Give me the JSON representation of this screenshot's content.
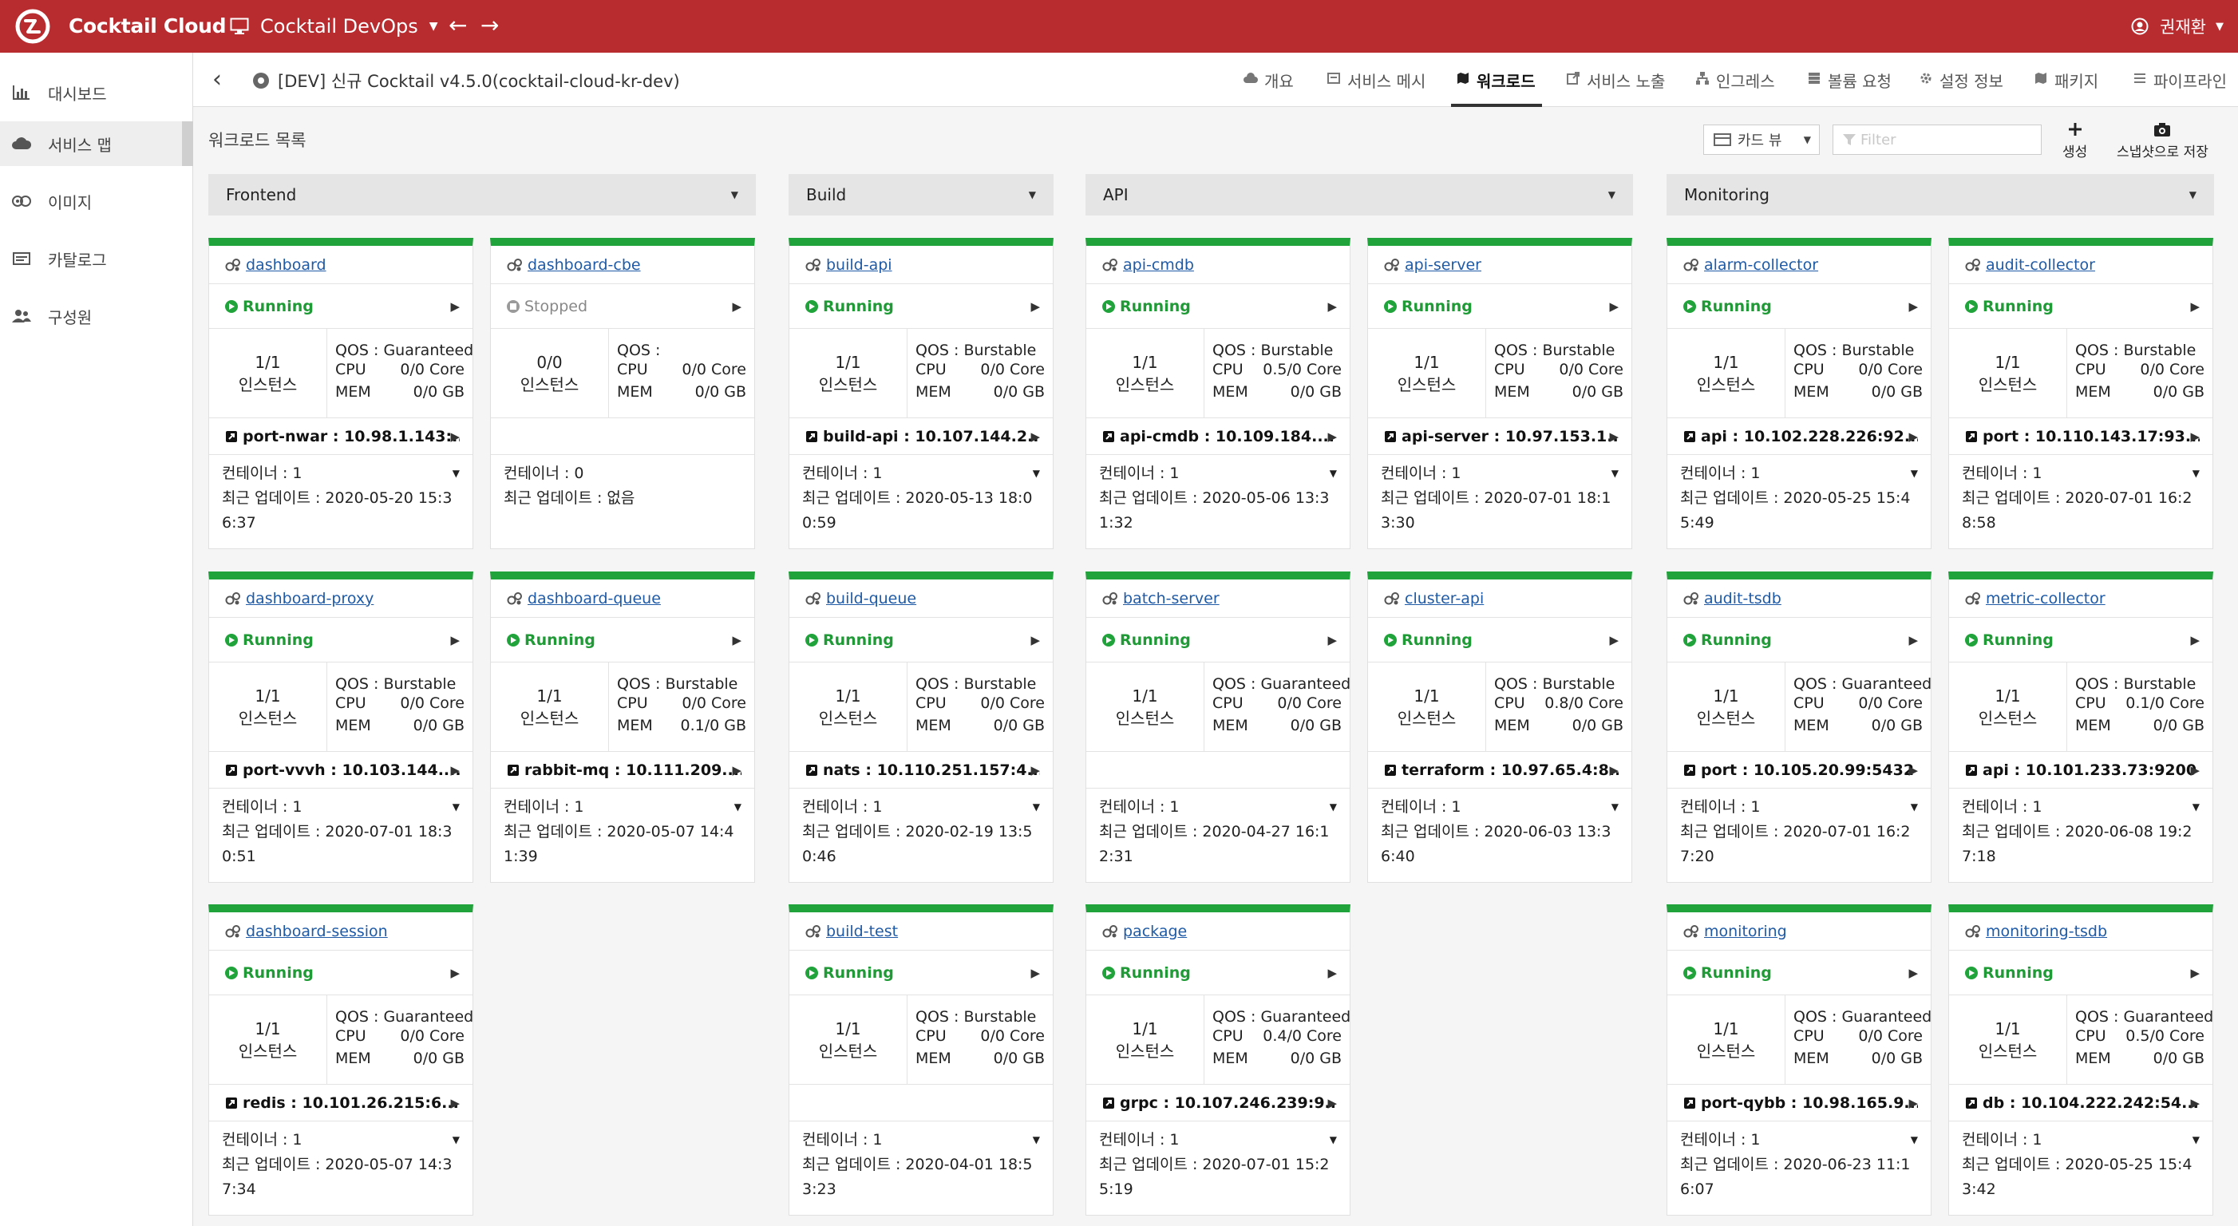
{
  "app": {
    "brand": "Cocktail Cloud",
    "project": "Cocktail DevOps",
    "user": "권재환",
    "accent": "#b82c30"
  },
  "sidebar": {
    "items": [
      {
        "label": "대시보드",
        "icon": "bar-chart-icon"
      },
      {
        "label": "서비스 맵",
        "icon": "cloud-icon",
        "active": true
      },
      {
        "label": "이미지",
        "icon": "images-icon"
      },
      {
        "label": "카탈로그",
        "icon": "catalog-icon"
      },
      {
        "label": "구성원",
        "icon": "users-icon"
      }
    ]
  },
  "subheader": {
    "cluster": "[DEV] 신규 Cocktail v4.5.0(cocktail-cloud-kr-dev)",
    "tabs": [
      {
        "label": "개요",
        "icon": "cloud-icon"
      },
      {
        "label": "서비스 메시",
        "icon": "mesh-icon"
      },
      {
        "label": "워크로드",
        "icon": "workload-icon",
        "active": true
      },
      {
        "label": "서비스 노출",
        "icon": "expose-icon"
      },
      {
        "label": "인그레스",
        "icon": "ingress-icon"
      },
      {
        "label": "볼륨 요청",
        "icon": "volume-icon"
      },
      {
        "label": "설정 정보",
        "icon": "gear-icon"
      },
      {
        "label": "패키지",
        "icon": "package-icon"
      },
      {
        "label": "파이프라인",
        "icon": "pipeline-icon"
      }
    ]
  },
  "toolbar": {
    "title": "워크로드 목록",
    "view": "카드 뷰",
    "filter_placeholder": "Filter",
    "create": "생성",
    "snapshot": "스냅샷으로 저장"
  },
  "groups": [
    {
      "name": "Frontend"
    },
    {
      "name": "Build"
    },
    {
      "name": "API"
    },
    {
      "name": "Monitoring"
    }
  ],
  "labels": {
    "instance": "인스턴스",
    "cpu": "CPU",
    "mem": "MEM",
    "running": "Running",
    "stopped": "Stopped"
  },
  "cards": [
    {
      "name": "dashboard",
      "status": "Running",
      "instances": "1/1",
      "qos": "QOS : Guaranteed",
      "cpu": "0/0 Core",
      "mem": "0/0 GB",
      "port": "port-nwar : 10.98.1.143:...",
      "containers": "컨테이너 : 1",
      "updated": "최근 업데이트 : 2020-05-20 15:36:37"
    },
    {
      "name": "dashboard-cbe",
      "status": "Stopped",
      "instances": "0/0",
      "qos": "QOS :",
      "cpu": "0/0 Core",
      "mem": "0/0 GB",
      "port": "",
      "containers": "컨테이너 : 0",
      "updated": "최근 업데이트 : 없음"
    },
    {
      "name": "build-api",
      "status": "Running",
      "instances": "1/1",
      "qos": "QOS : Burstable",
      "cpu": "0/0 Core",
      "mem": "0/0 GB",
      "port": "build-api : 10.107.144.2...",
      "containers": "컨테이너 : 1",
      "updated": "최근 업데이트 : 2020-05-13 18:00:59"
    },
    {
      "name": "api-cmdb",
      "status": "Running",
      "instances": "1/1",
      "qos": "QOS : Burstable",
      "cpu": "0.5/0 Core",
      "mem": "0/0 GB",
      "port": "api-cmdb : 10.109.184....",
      "containers": "컨테이너 : 1",
      "updated": "최근 업데이트 : 2020-05-06 13:31:32"
    },
    {
      "name": "api-server",
      "status": "Running",
      "instances": "1/1",
      "qos": "QOS : Burstable",
      "cpu": "0/0 Core",
      "mem": "0/0 GB",
      "port": "api-server : 10.97.153.1...",
      "containers": "컨테이너 : 1",
      "updated": "최근 업데이트 : 2020-07-01 18:13:30"
    },
    {
      "name": "alarm-collector",
      "status": "Running",
      "instances": "1/1",
      "qos": "QOS : Burstable",
      "cpu": "0/0 Core",
      "mem": "0/0 GB",
      "port": "api : 10.102.228.226:92...",
      "containers": "컨테이너 : 1",
      "updated": "최근 업데이트 : 2020-05-25 15:45:49"
    },
    {
      "name": "audit-collector",
      "status": "Running",
      "instances": "1/1",
      "qos": "QOS : Burstable",
      "cpu": "0/0 Core",
      "mem": "0/0 GB",
      "port": "port : 10.110.143.17:93...",
      "containers": "컨테이너 : 1",
      "updated": "최근 업데이트 : 2020-07-01 16:28:58"
    },
    {
      "name": "dashboard-proxy",
      "status": "Running",
      "instances": "1/1",
      "qos": "QOS : Burstable",
      "cpu": "0/0 Core",
      "mem": "0/0 GB",
      "port": "port-vvvh : 10.103.144....",
      "containers": "컨테이너 : 1",
      "updated": "최근 업데이트 : 2020-07-01 18:30:51"
    },
    {
      "name": "dashboard-queue",
      "status": "Running",
      "instances": "1/1",
      "qos": "QOS : Burstable",
      "cpu": "0/0 Core",
      "mem": "0.1/0 GB",
      "port": "rabbit-mq : 10.111.209....",
      "containers": "컨테이너 : 1",
      "updated": "최근 업데이트 : 2020-05-07 14:41:39"
    },
    {
      "name": "build-queue",
      "status": "Running",
      "instances": "1/1",
      "qos": "QOS : Burstable",
      "cpu": "0/0 Core",
      "mem": "0/0 GB",
      "port": "nats : 10.110.251.157:4...",
      "containers": "컨테이너 : 1",
      "updated": "최근 업데이트 : 2020-02-19 13:50:46"
    },
    {
      "name": "batch-server",
      "status": "Running",
      "instances": "1/1",
      "qos": "QOS : Guaranteed",
      "cpu": "0/0 Core",
      "mem": "0/0 GB",
      "port": "",
      "containers": "컨테이너 : 1",
      "updated": "최근 업데이트 : 2020-04-27 16:12:31"
    },
    {
      "name": "cluster-api",
      "status": "Running",
      "instances": "1/1",
      "qos": "QOS : Burstable",
      "cpu": "0.8/0 Core",
      "mem": "0/0 GB",
      "port": "terraform : 10.97.65.4:8...",
      "containers": "컨테이너 : 1",
      "updated": "최근 업데이트 : 2020-06-03 13:36:40"
    },
    {
      "name": "audit-tsdb",
      "status": "Running",
      "instances": "1/1",
      "qos": "QOS : Guaranteed",
      "cpu": "0/0 Core",
      "mem": "0/0 GB",
      "port": "port : 10.105.20.99:5432",
      "containers": "컨테이너 : 1",
      "updated": "최근 업데이트 : 2020-07-01 16:27:20"
    },
    {
      "name": "metric-collector",
      "status": "Running",
      "instances": "1/1",
      "qos": "QOS : Burstable",
      "cpu": "0.1/0 Core",
      "mem": "0/0 GB",
      "port": "api : 10.101.233.73:9200",
      "containers": "컨테이너 : 1",
      "updated": "최근 업데이트 : 2020-06-08 19:27:18"
    },
    {
      "name": "dashboard-session",
      "status": "Running",
      "instances": "1/1",
      "qos": "QOS : Guaranteed",
      "cpu": "0/0 Core",
      "mem": "0/0 GB",
      "port": "redis : 10.101.26.215:6...",
      "containers": "컨테이너 : 1",
      "updated": "최근 업데이트 : 2020-05-07 14:37:34"
    },
    {
      "name": "build-test",
      "status": "Running",
      "instances": "1/1",
      "qos": "QOS : Burstable",
      "cpu": "0/0 Core",
      "mem": "0/0 GB",
      "port": "",
      "containers": "컨테이너 : 1",
      "updated": "최근 업데이트 : 2020-04-01 18:53:23"
    },
    {
      "name": "package",
      "status": "Running",
      "instances": "1/1",
      "qos": "QOS : Guaranteed",
      "cpu": "0.4/0 Core",
      "mem": "0/0 GB",
      "port": "grpc : 10.107.246.239:9...",
      "containers": "컨테이너 : 1",
      "updated": "최근 업데이트 : 2020-07-01 15:25:19"
    },
    {
      "name": "monitoring",
      "status": "Running",
      "instances": "1/1",
      "qos": "QOS : Guaranteed",
      "cpu": "0/0 Core",
      "mem": "0/0 GB",
      "port": "port-qybb : 10.98.165.9...",
      "containers": "컨테이너 : 1",
      "updated": "최근 업데이트 : 2020-06-23 11:16:07"
    },
    {
      "name": "monitoring-tsdb",
      "status": "Running",
      "instances": "1/1",
      "qos": "QOS : Guaranteed",
      "cpu": "0.5/0 Core",
      "mem": "0/0 GB",
      "port": "db : 10.104.222.242:54...",
      "containers": "컨테이너 : 1",
      "updated": "최근 업데이트 : 2020-05-25 15:43:42"
    }
  ]
}
